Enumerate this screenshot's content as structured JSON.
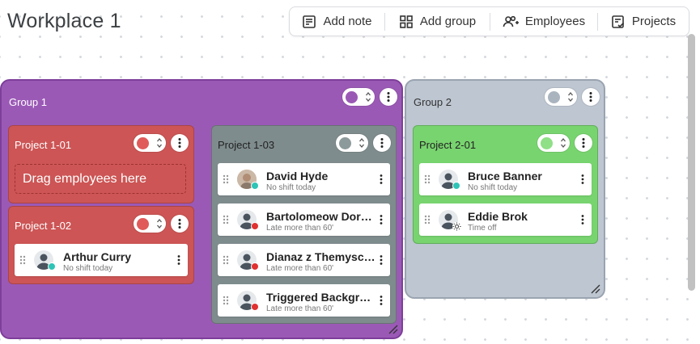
{
  "page": {
    "title": "Workplace 1"
  },
  "toolbar": {
    "add_note": "Add note",
    "add_group": "Add group",
    "employees": "Employees",
    "projects": "Projects"
  },
  "groups": [
    {
      "name": "Group 1",
      "color": "#9b59b6",
      "border": "#7d3e9a",
      "dot": "#9b59b6",
      "projects": [
        {
          "name": "Project 1-01",
          "color": "#cd5555",
          "dot": "#e05a5a",
          "drop_text": "Drag employees here",
          "employees": []
        },
        {
          "name": "Project 1-02",
          "color": "#cd5555",
          "dot": "#e05a5a",
          "employees": [
            {
              "name": "Arthur  Curry",
              "status": "No shift today",
              "status_color": "#2ec4b6",
              "avatar": "silhouette"
            }
          ]
        },
        {
          "name": "Project 1-03",
          "color": "#7f8c8d",
          "dot": "#8d9a9b",
          "employees": [
            {
              "name": "David Hyde",
              "status": "No shift today",
              "status_color": "#2ec4b6",
              "avatar": "photo"
            },
            {
              "name": "Bartolomeow Dorrington",
              "status": "Late more than 60'",
              "status_color": "#e03131",
              "avatar": "silhouette"
            },
            {
              "name": "Dianaz z Themysciry",
              "status": "Late more than 60'",
              "status_color": "#e03131",
              "avatar": "silhouette"
            },
            {
              "name": "Triggered Background",
              "status": "Late more than 60'",
              "status_color": "#e03131",
              "avatar": "silhouette"
            }
          ]
        }
      ]
    },
    {
      "name": "Group 2",
      "color": "#bdc6d1",
      "border": "#9aa4b0",
      "dot": "#aab4bf",
      "projects": [
        {
          "name": "Project 2-01",
          "color": "#78d46f",
          "dot": "#8fe086",
          "employees": [
            {
              "name": "Bruce Banner",
              "status": "No shift today",
              "status_color": "#2ec4b6",
              "avatar": "silhouette"
            },
            {
              "name": "Eddie Brok",
              "status": "Time off",
              "status_color": "#ffffff",
              "avatar": "silhouette"
            }
          ]
        }
      ]
    }
  ]
}
